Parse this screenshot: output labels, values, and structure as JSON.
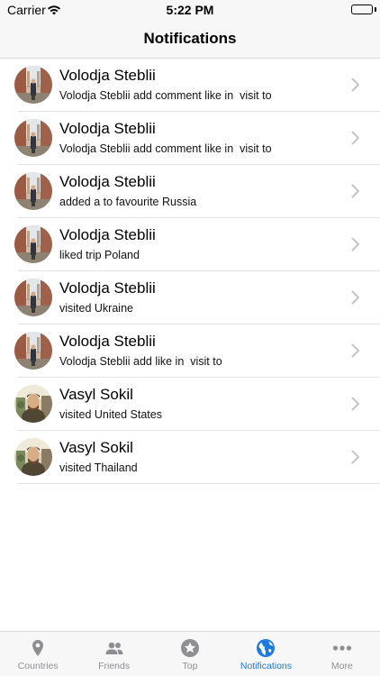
{
  "status_bar": {
    "carrier": "Carrier",
    "time": "5:22 PM"
  },
  "nav": {
    "title": "Notifications"
  },
  "notifications": [
    {
      "name": "Volodja Steblii",
      "text": "Volodja Steblii add comment like in  visit to",
      "avatar": "volodja"
    },
    {
      "name": "Volodja Steblii",
      "text": "Volodja Steblii add comment like in  visit to",
      "avatar": "volodja"
    },
    {
      "name": "Volodja Steblii",
      "text": "added a to favourite Russia",
      "avatar": "volodja"
    },
    {
      "name": "Volodja Steblii",
      "text": "liked trip Poland",
      "avatar": "volodja"
    },
    {
      "name": "Volodja Steblii",
      "text": "visited Ukraine",
      "avatar": "volodja"
    },
    {
      "name": "Volodja Steblii",
      "text": "Volodja Steblii add like in  visit to",
      "avatar": "volodja"
    },
    {
      "name": "Vasyl Sokil",
      "text": "visited United States",
      "avatar": "vasyl"
    },
    {
      "name": "Vasyl Sokil",
      "text": "visited Thailand",
      "avatar": "vasyl"
    }
  ],
  "tabs": [
    {
      "label": "Countries",
      "icon": "location-pin-icon",
      "active": false
    },
    {
      "label": "Friends",
      "icon": "people-icon",
      "active": false
    },
    {
      "label": "Top",
      "icon": "star-icon",
      "active": false
    },
    {
      "label": "Notifications",
      "icon": "globe-icon",
      "active": true
    },
    {
      "label": "More",
      "icon": "more-dots-icon",
      "active": false
    }
  ],
  "colors": {
    "active_tab": "#1a7ae0",
    "inactive_tab": "#8e8e93",
    "bar_background": "#f7f7f7"
  }
}
